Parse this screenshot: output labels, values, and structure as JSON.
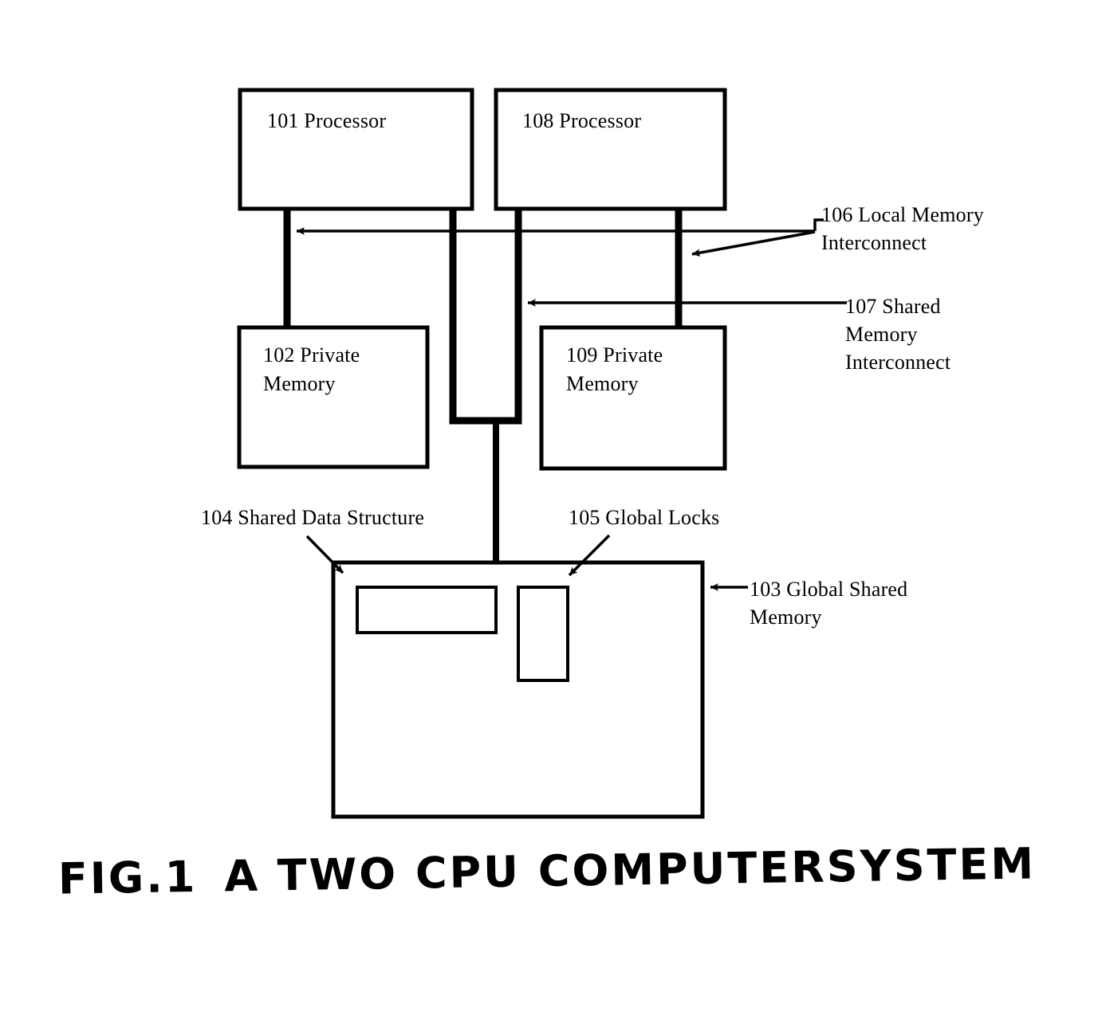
{
  "figure": {
    "caption_part1": "FIG.1",
    "caption_part2": "A TWO CPU COMPUTERSYSTEM",
    "ink_color": "#000000",
    "background_color": "#ffffff"
  },
  "blocks": [
    {
      "id": "101",
      "name": "processor-left",
      "label": "101 Processor"
    },
    {
      "id": "108",
      "name": "processor-right",
      "label": "108 Processor"
    },
    {
      "id": "102",
      "name": "private-memory-left",
      "label": "102 Private\nMemory"
    },
    {
      "id": "109",
      "name": "private-memory-right",
      "label": "109 Private\nMemory"
    },
    {
      "id": "103",
      "name": "global-shared-memory",
      "label": "103 Global Shared\nMemory"
    },
    {
      "id": "104",
      "name": "shared-data-structure",
      "label": "104 Shared Data Structure"
    },
    {
      "id": "105",
      "name": "global-locks",
      "label": "105 Global Locks"
    }
  ],
  "callouts": [
    {
      "id": "106",
      "name": "local-memory-interconnect",
      "label": "106 Local Memory\nInterconnect"
    },
    {
      "id": "107",
      "name": "shared-memory-interconnect",
      "label": "107 Shared\nMemory\nInterconnect"
    },
    {
      "id": "103",
      "name": "global-shared-memory-callout",
      "label": "103 Global Shared\nMemory"
    },
    {
      "id": "104",
      "name": "shared-data-structure-callout",
      "label": "104 Shared Data Structure"
    },
    {
      "id": "105",
      "name": "global-locks-callout",
      "label": "105 Global Locks"
    }
  ]
}
